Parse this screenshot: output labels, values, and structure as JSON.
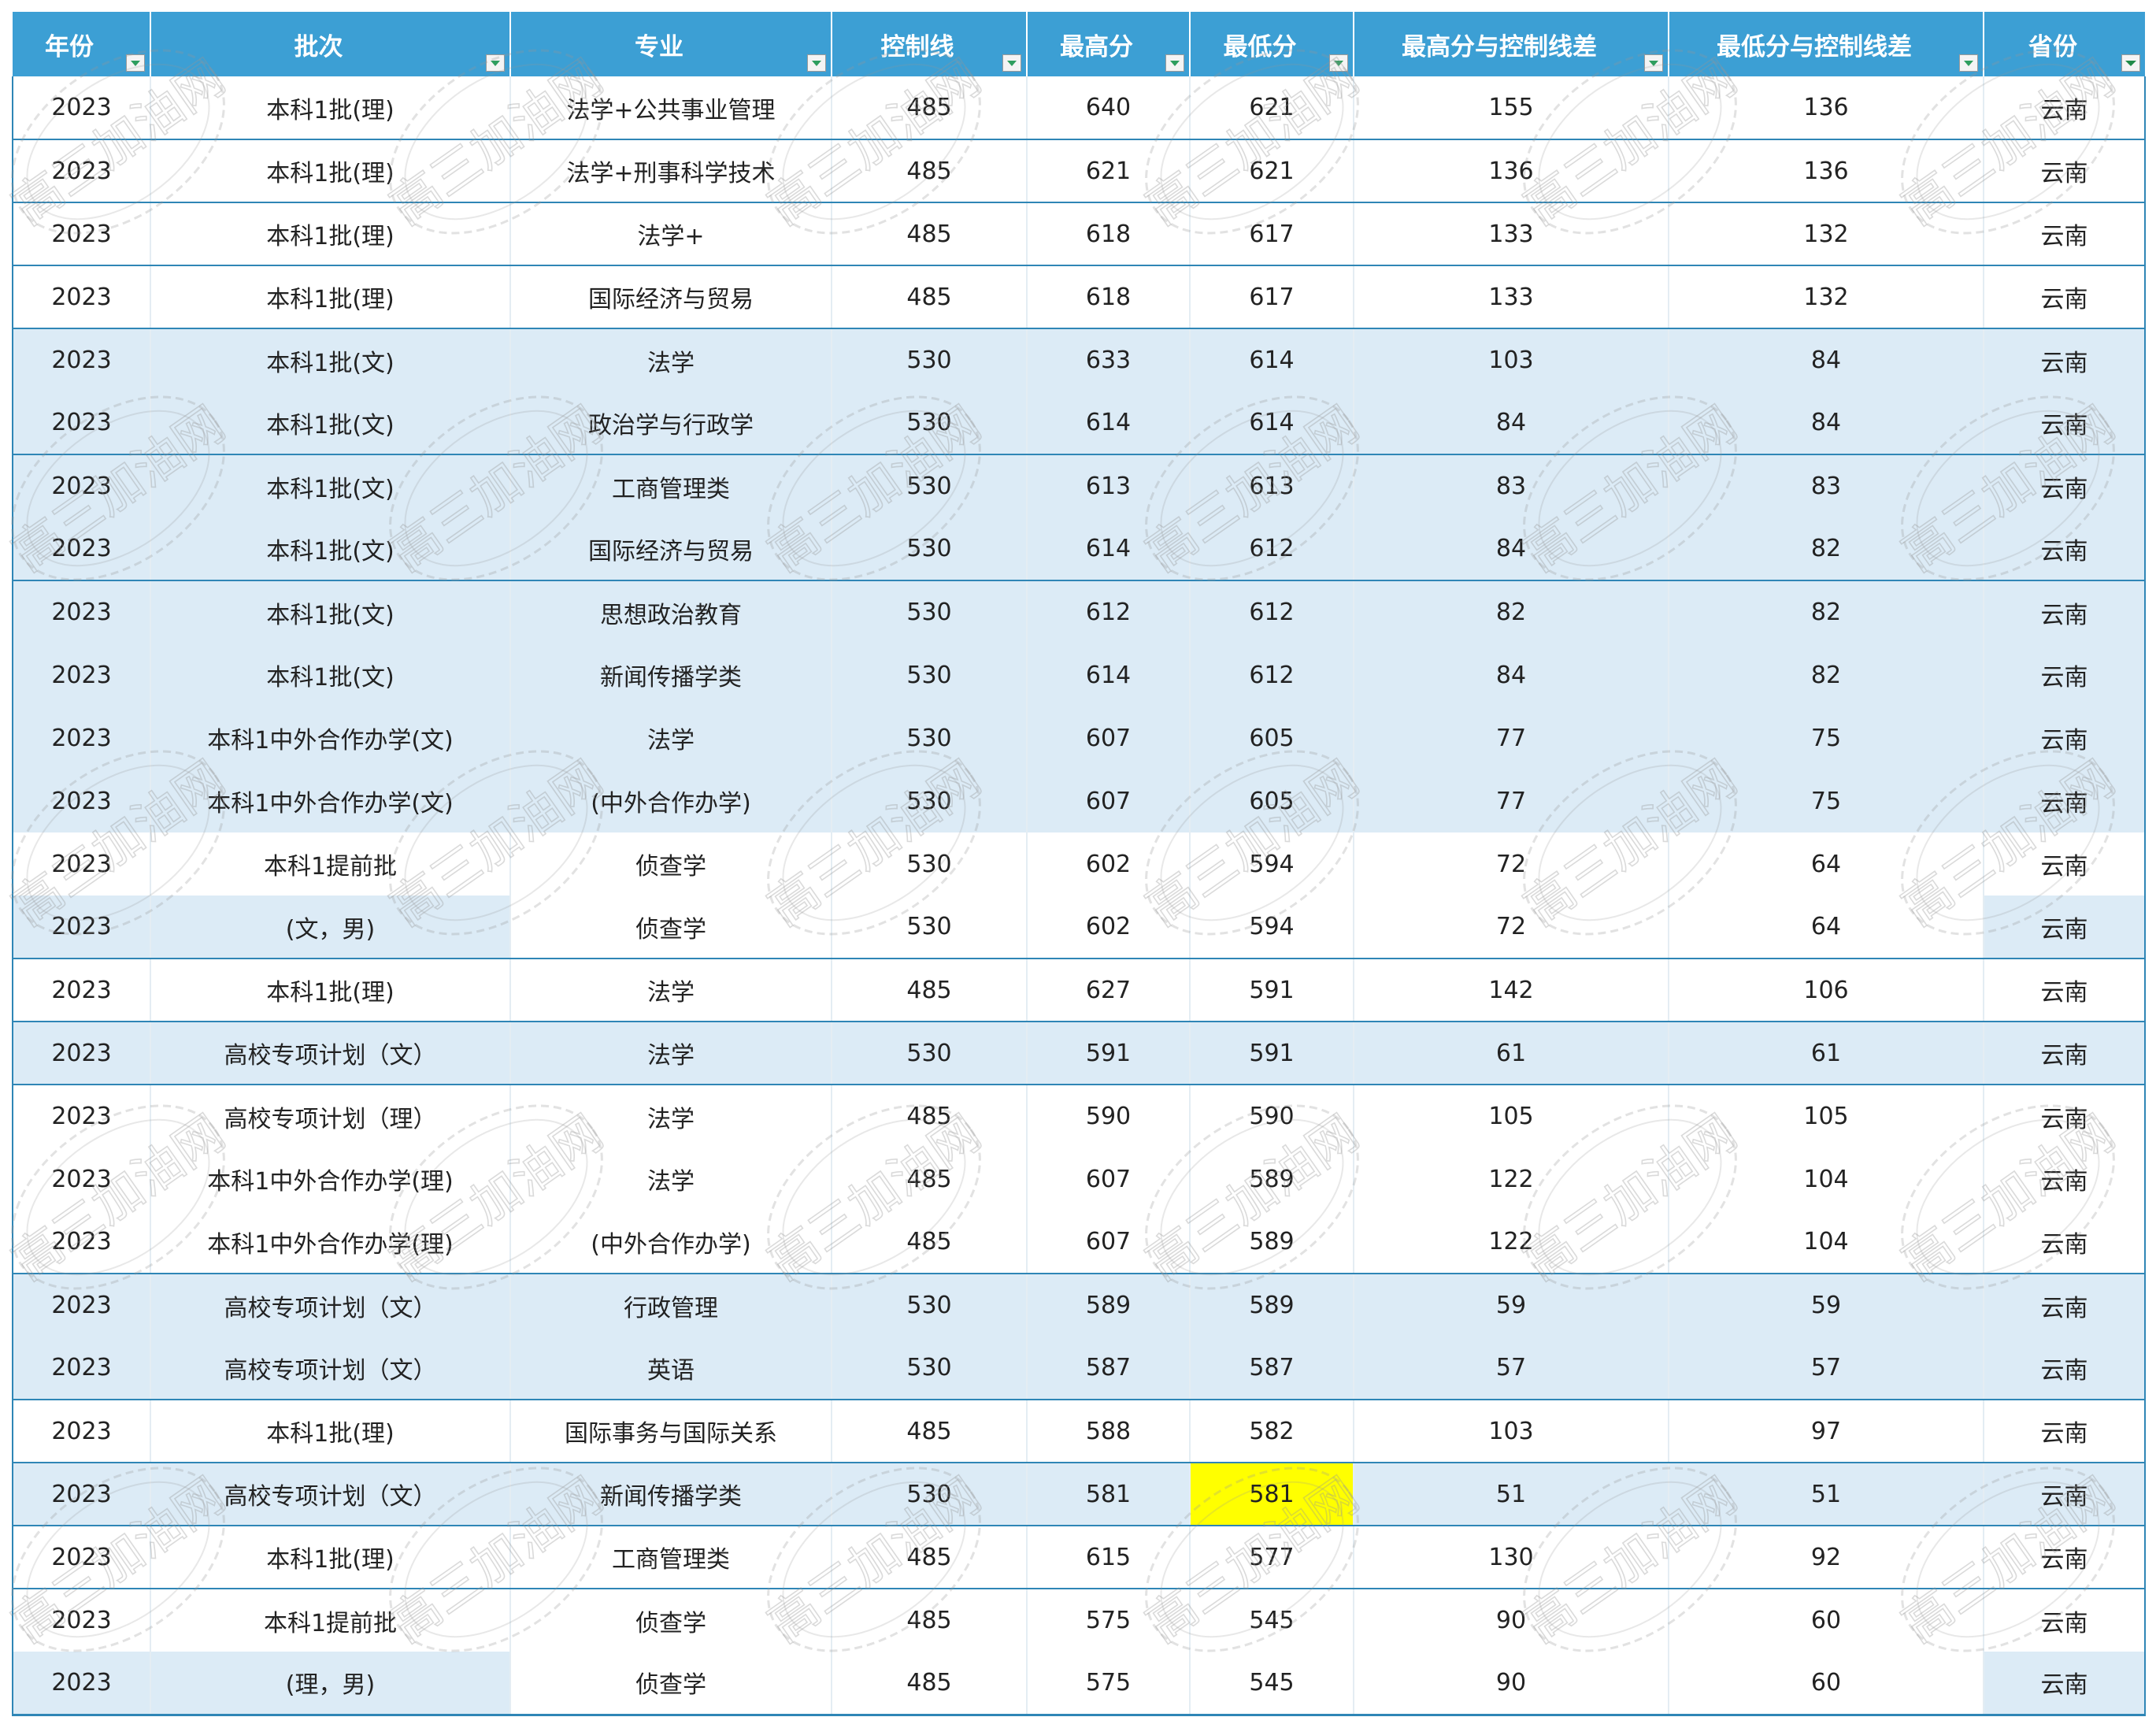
{
  "headers": [
    "年份",
    "批次",
    "专业",
    "控制线",
    "最高分",
    "最低分",
    "最高分与控制线差",
    "最低分与控制线差",
    "省份"
  ],
  "watermark_text": "高三加油网",
  "colors": {
    "header": "#3c9fd4",
    "row_blue": "#dcebf6",
    "highlight": "#ffff00"
  },
  "rows": [
    [
      "2023",
      "本科1批(理)",
      "法学+公共事业管理",
      "485",
      "640",
      "621",
      "155",
      "136",
      "云南"
    ],
    [
      "2023",
      "本科1批(理)",
      "法学+刑事科学技术",
      "485",
      "621",
      "621",
      "136",
      "136",
      "云南"
    ],
    [
      "2023",
      "本科1批(理)",
      "法学+",
      "485",
      "618",
      "617",
      "133",
      "132",
      "云南"
    ],
    [
      "2023",
      "本科1批(理)",
      "国际经济与贸易",
      "485",
      "618",
      "617",
      "133",
      "132",
      "云南"
    ],
    [
      "2023",
      "本科1批(文)",
      "法学",
      "530",
      "633",
      "614",
      "103",
      "84",
      "云南"
    ],
    [
      "2023",
      "本科1批(文)",
      "政治学与行政学",
      "530",
      "614",
      "614",
      "84",
      "84",
      "云南"
    ],
    [
      "2023",
      "本科1批(文)",
      "工商管理类",
      "530",
      "613",
      "613",
      "83",
      "83",
      "云南"
    ],
    [
      "2023",
      "本科1批(文)",
      "国际经济与贸易",
      "530",
      "614",
      "612",
      "84",
      "82",
      "云南"
    ],
    [
      "2023",
      "本科1批(文)",
      "思想政治教育",
      "530",
      "612",
      "612",
      "82",
      "82",
      "云南"
    ],
    [
      "2023",
      "本科1批(文)",
      "新闻传播学类",
      "530",
      "614",
      "612",
      "84",
      "82",
      "云南"
    ],
    [
      "2023",
      "本科1中外合作办学(文)",
      "法学",
      "530",
      "607",
      "605",
      "77",
      "75",
      "云南"
    ],
    [
      "2023",
      "本科1中外合作办学(文)",
      "(中外合作办学)",
      "530",
      "607",
      "605",
      "77",
      "75",
      "云南"
    ],
    [
      "2023",
      "本科1提前批",
      "侦查学",
      "530",
      "602",
      "594",
      "72",
      "64",
      "云南"
    ],
    [
      "2023",
      "(文，男)",
      "侦查学",
      "530",
      "602",
      "594",
      "72",
      "64",
      "云南"
    ],
    [
      "2023",
      "本科1批(理)",
      "法学",
      "485",
      "627",
      "591",
      "142",
      "106",
      "云南"
    ],
    [
      "2023",
      "高校专项计划（文）",
      "法学",
      "530",
      "591",
      "591",
      "61",
      "61",
      "云南"
    ],
    [
      "2023",
      "高校专项计划（理）",
      "法学",
      "485",
      "590",
      "590",
      "105",
      "105",
      "云南"
    ],
    [
      "2023",
      "本科1中外合作办学(理)",
      "法学",
      "485",
      "607",
      "589",
      "122",
      "104",
      "云南"
    ],
    [
      "2023",
      "本科1中外合作办学(理)",
      "(中外合作办学)",
      "485",
      "607",
      "589",
      "122",
      "104",
      "云南"
    ],
    [
      "2023",
      "高校专项计划（文）",
      "行政管理",
      "530",
      "589",
      "589",
      "59",
      "59",
      "云南"
    ],
    [
      "2023",
      "高校专项计划（文）",
      "英语",
      "530",
      "587",
      "587",
      "57",
      "57",
      "云南"
    ],
    [
      "2023",
      "本科1批(理)",
      "国际事务与国际关系",
      "485",
      "588",
      "582",
      "103",
      "97",
      "云南"
    ],
    [
      "2023",
      "高校专项计划（文）",
      "新闻传播学类",
      "530",
      "581",
      "581",
      "51",
      "51",
      "云南"
    ],
    [
      "2023",
      "本科1批(理)",
      "工商管理类",
      "485",
      "615",
      "577",
      "130",
      "92",
      "云南"
    ],
    [
      "2023",
      "本科1提前批",
      "侦查学",
      "485",
      "575",
      "545",
      "90",
      "60",
      "云南"
    ],
    [
      "2023",
      "(理，男)",
      "侦查学",
      "485",
      "575",
      "545",
      "90",
      "60",
      "云南"
    ]
  ]
}
